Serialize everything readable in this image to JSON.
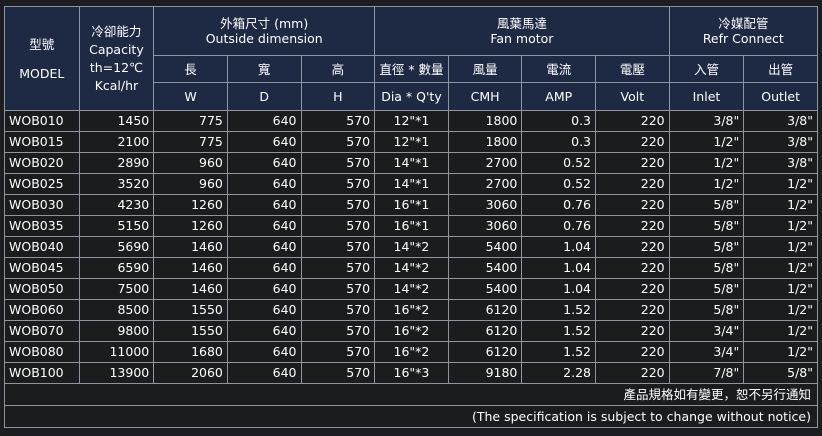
{
  "header": {
    "model_zh": "型號",
    "model_en": "MODEL",
    "capacity_lines": [
      "冷卻能力",
      "Capacity",
      "th=12℃",
      "Kcal/hr"
    ],
    "outside": {
      "zh": "外箱尺寸 (mm)",
      "en": "Outside dimension"
    },
    "fan": {
      "zh": "風葉馬達",
      "en": "Fan motor"
    },
    "refr": {
      "zh": "冷媒配管",
      "en": "Refr Connect"
    },
    "columns": [
      {
        "zh": "長",
        "en": "W"
      },
      {
        "zh": "寬",
        "en": "D"
      },
      {
        "zh": "高",
        "en": "H"
      },
      {
        "zh": "直徑 * 數量",
        "en": "Dia * Q'ty"
      },
      {
        "zh": "風量",
        "en": "CMH"
      },
      {
        "zh": "電流",
        "en": "AMP"
      },
      {
        "zh": "電壓",
        "en": "Volt"
      },
      {
        "zh": "入管",
        "en": "Inlet"
      },
      {
        "zh": "出管",
        "en": "Outlet"
      }
    ]
  },
  "rows": [
    [
      "WOB010",
      "1450",
      "775",
      "640",
      "570",
      "12\"*1",
      "1800",
      "0.3",
      "220",
      "3/8\"",
      "3/8\""
    ],
    [
      "WOB015",
      "2100",
      "775",
      "640",
      "570",
      "12\"*1",
      "1800",
      "0.3",
      "220",
      "1/2\"",
      "3/8\""
    ],
    [
      "WOB020",
      "2890",
      "960",
      "640",
      "570",
      "14\"*1",
      "2700",
      "0.52",
      "220",
      "1/2\"",
      "3/8\""
    ],
    [
      "WOB025",
      "3520",
      "960",
      "640",
      "570",
      "14\"*1",
      "2700",
      "0.52",
      "220",
      "1/2\"",
      "1/2\""
    ],
    [
      "WOB030",
      "4230",
      "1260",
      "640",
      "570",
      "16\"*1",
      "3060",
      "0.76",
      "220",
      "5/8\"",
      "1/2\""
    ],
    [
      "WOB035",
      "5150",
      "1260",
      "640",
      "570",
      "16\"*1",
      "3060",
      "0.76",
      "220",
      "5/8\"",
      "1/2\""
    ],
    [
      "WOB040",
      "5690",
      "1460",
      "640",
      "570",
      "14\"*2",
      "5400",
      "1.04",
      "220",
      "5/8\"",
      "1/2\""
    ],
    [
      "WOB045",
      "6590",
      "1460",
      "640",
      "570",
      "14\"*2",
      "5400",
      "1.04",
      "220",
      "5/8\"",
      "1/2\""
    ],
    [
      "WOB050",
      "7500",
      "1460",
      "640",
      "570",
      "14\"*2",
      "5400",
      "1.04",
      "220",
      "5/8\"",
      "1/2\""
    ],
    [
      "WOB060",
      "8500",
      "1550",
      "640",
      "570",
      "16\"*2",
      "6120",
      "1.52",
      "220",
      "5/8\"",
      "1/2\""
    ],
    [
      "WOB070",
      "9800",
      "1550",
      "640",
      "570",
      "16\"*2",
      "6120",
      "1.52",
      "220",
      "3/4\"",
      "1/2\""
    ],
    [
      "WOB080",
      "11000",
      "1680",
      "640",
      "570",
      "16\"*2",
      "6120",
      "1.52",
      "220",
      "3/4\"",
      "1/2\""
    ],
    [
      "WOB100",
      "13900",
      "2060",
      "640",
      "570",
      "16\"*3",
      "9180",
      "2.28",
      "220",
      "7/8\"",
      "5/8\""
    ]
  ],
  "footer": {
    "note_zh": "產品規格如有變更，恕不另行通知",
    "note_en": "(The specification is subject to change without notice)"
  }
}
